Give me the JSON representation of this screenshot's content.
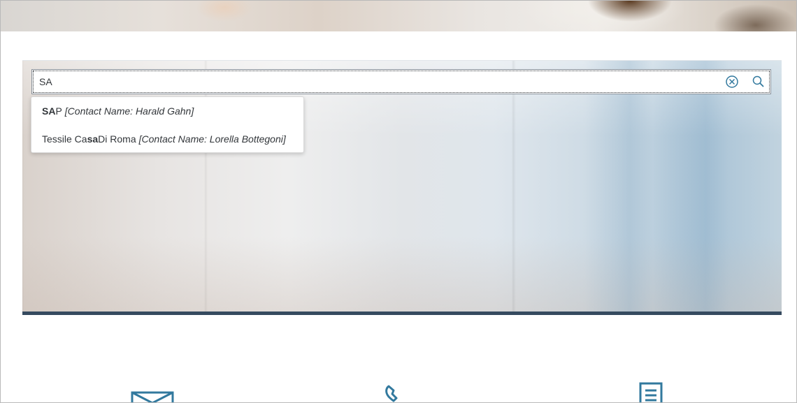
{
  "search": {
    "value": "SA",
    "clear_icon": "clear-circle-icon",
    "search_icon": "search-icon"
  },
  "suggestions": [
    {
      "pre": "",
      "match": "SA",
      "post": "P",
      "contact": "[Contact Name: Harald Gahn]"
    },
    {
      "pre": "Tessile Ca",
      "match": "sa",
      "post": " Di Roma",
      "contact": "[Contact Name: Lorella Bottegoni]"
    }
  ],
  "tiles": {
    "icons": [
      "envelope-icon",
      "phone-icon",
      "document-icon"
    ]
  },
  "colors": {
    "accent": "#32799e",
    "shell_bar": "#354a5f",
    "text": "#32363a"
  }
}
